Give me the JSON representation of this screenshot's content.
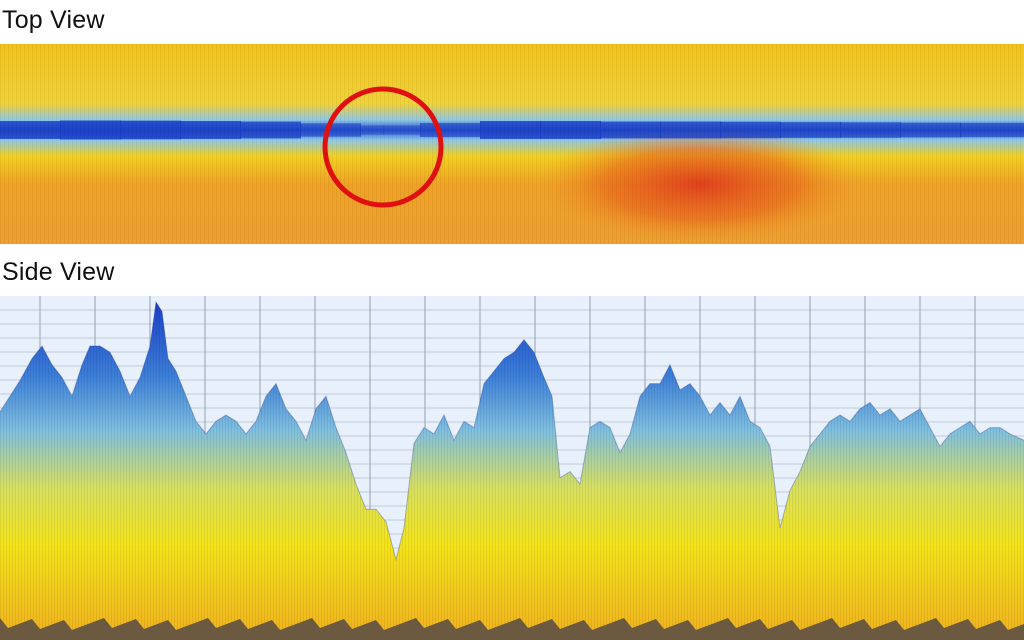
{
  "top_view": {
    "title": "Top View"
  },
  "side_view": {
    "title": "Side View"
  },
  "colors": {
    "blue": "#1a3fc8",
    "light_blue": "#4fa6e0",
    "yellow": "#f2e21a",
    "orange": "#f0a020",
    "red": "#e0401a",
    "highlight_circle": "#e01010",
    "grid_background": "#e8f0fb",
    "ground": "#6b5a40"
  },
  "chart_data": [
    {
      "type": "heatmap",
      "title": "Top View",
      "annotation": {
        "shape": "circle",
        "color": "#e01010",
        "x": 383,
        "y": 103
      },
      "channel_profile": {
        "x": [
          0,
          60,
          120,
          180,
          240,
          300,
          360,
          383,
          420,
          480,
          540,
          600,
          660,
          720,
          780,
          840,
          900,
          960,
          1024
        ],
        "depth": [
          0.8,
          0.9,
          0.95,
          0.85,
          0.85,
          0.7,
          0.35,
          0.15,
          0.35,
          0.8,
          0.9,
          0.8,
          0.75,
          0.8,
          0.7,
          0.7,
          0.65,
          0.6,
          0.6
        ]
      },
      "heat_zone": {
        "x_from": 540,
        "x_to": 860,
        "intensity": 0.9
      }
    },
    {
      "type": "area",
      "title": "Side View",
      "x": [
        0,
        10,
        20,
        32,
        42,
        52,
        62,
        72,
        82,
        90,
        100,
        110,
        120,
        130,
        140,
        150,
        156,
        162,
        168,
        176,
        186,
        196,
        206,
        216,
        226,
        236,
        246,
        256,
        266,
        276,
        286,
        296,
        306,
        316,
        326,
        336,
        346,
        356,
        366,
        376,
        386,
        396,
        404,
        414,
        424,
        434,
        444,
        454,
        464,
        474,
        484,
        494,
        504,
        514,
        524,
        534,
        544,
        552,
        560,
        570,
        580,
        590,
        600,
        610,
        620,
        630,
        640,
        650,
        660,
        670,
        680,
        690,
        700,
        710,
        720,
        730,
        740,
        750,
        760,
        770,
        780,
        790,
        800,
        810,
        820,
        830,
        840,
        850,
        860,
        870,
        880,
        890,
        900,
        910,
        920,
        930,
        940,
        950,
        960,
        970,
        980,
        990,
        1000,
        1010,
        1024
      ],
      "height": [
        0.65,
        0.7,
        0.75,
        0.82,
        0.86,
        0.8,
        0.76,
        0.7,
        0.8,
        0.86,
        0.86,
        0.84,
        0.78,
        0.7,
        0.76,
        0.86,
        1.0,
        0.97,
        0.82,
        0.78,
        0.7,
        0.62,
        0.58,
        0.62,
        0.64,
        0.62,
        0.58,
        0.62,
        0.7,
        0.74,
        0.66,
        0.62,
        0.56,
        0.66,
        0.7,
        0.6,
        0.52,
        0.42,
        0.34,
        0.34,
        0.3,
        0.18,
        0.28,
        0.55,
        0.6,
        0.58,
        0.64,
        0.56,
        0.62,
        0.6,
        0.74,
        0.78,
        0.82,
        0.84,
        0.88,
        0.84,
        0.76,
        0.7,
        0.44,
        0.46,
        0.42,
        0.6,
        0.62,
        0.6,
        0.52,
        0.58,
        0.7,
        0.74,
        0.74,
        0.8,
        0.72,
        0.74,
        0.7,
        0.64,
        0.68,
        0.64,
        0.7,
        0.62,
        0.6,
        0.54,
        0.28,
        0.4,
        0.46,
        0.54,
        0.58,
        0.62,
        0.64,
        0.62,
        0.66,
        0.68,
        0.64,
        0.66,
        0.62,
        0.64,
        0.66,
        0.6,
        0.54,
        0.58,
        0.6,
        0.62,
        0.58,
        0.6,
        0.6,
        0.58,
        0.56
      ],
      "ylim": [
        0,
        1
      ],
      "grid": true
    }
  ]
}
